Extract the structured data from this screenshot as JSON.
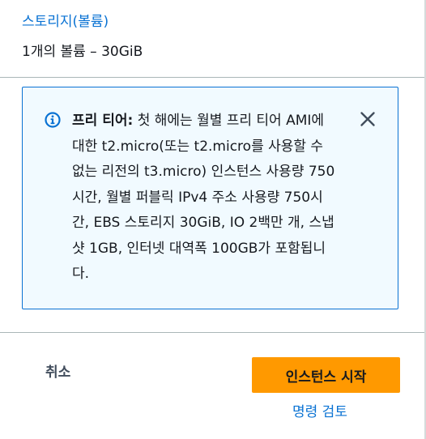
{
  "storage": {
    "heading_link": "스토리지(볼륨)",
    "summary": "1개의 볼륨 – 30GiB"
  },
  "free_tier_alert": {
    "icon": "info-icon",
    "title": "프리 티어:",
    "message": "첫 해에는 월별 프리 티어 AMI에 대한 t2.micro(또는 t2.micro를 사용할 수 없는 리전의 t3.micro) 인스턴스 사용량 750시간, 월별 퍼블릭 IPv4 주소 사용량 750시간, EBS 스토리지 30GiB, IO 2백만 개, 스냅샷 1GB, 인터넷 대역폭 100GB가 포함됩니다.",
    "dismiss_icon": "close-icon"
  },
  "actions": {
    "cancel_label": "취소",
    "launch_label": "인스턴스 시작",
    "review_label": "명령 검토"
  },
  "colors": {
    "link": "#0972d3",
    "primary_button": "#ff9900",
    "alert_background": "#f1faff",
    "alert_border": "#0972d3",
    "text": "#16191f"
  }
}
